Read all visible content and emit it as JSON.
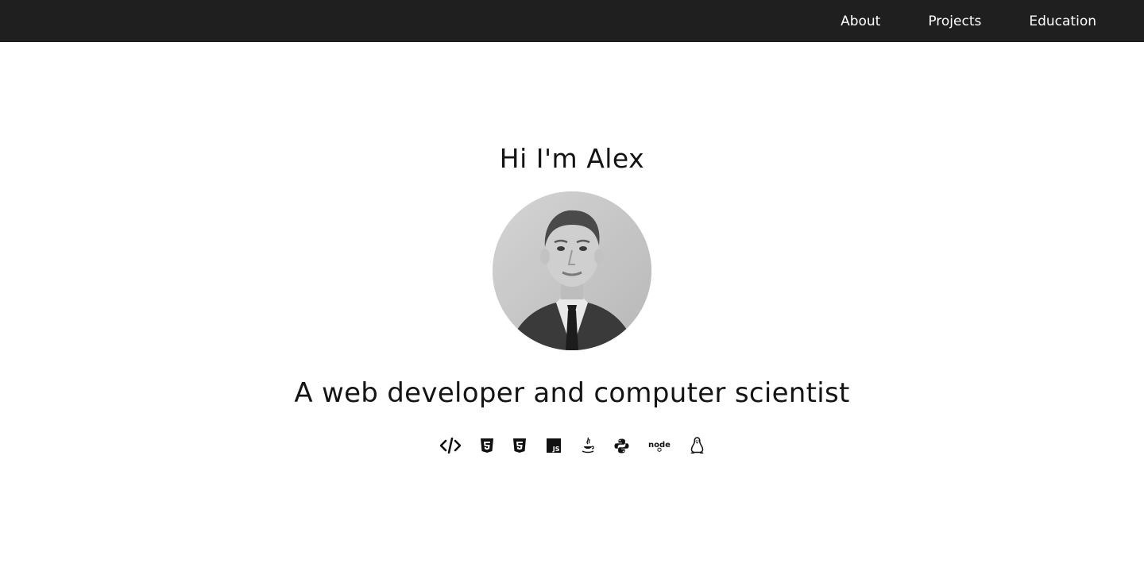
{
  "nav": {
    "links": [
      {
        "label": "About"
      },
      {
        "label": "Projects"
      },
      {
        "label": "Education"
      }
    ]
  },
  "hero": {
    "title": "Hi I'm Alex",
    "tagline": "A web developer and computer scientist",
    "avatar_icon": "profile-photo",
    "tech_icons": [
      "code-icon",
      "html5-icon",
      "css3-icon",
      "javascript-icon",
      "java-icon",
      "python-icon",
      "nodejs-icon",
      "linux-icon"
    ],
    "node_text": "node",
    "js_text": "JS"
  },
  "colors": {
    "navbar_bg": "#1f1f1f",
    "nav_text": "#ffffff",
    "page_bg": "#ffffff",
    "text": "#141414"
  }
}
